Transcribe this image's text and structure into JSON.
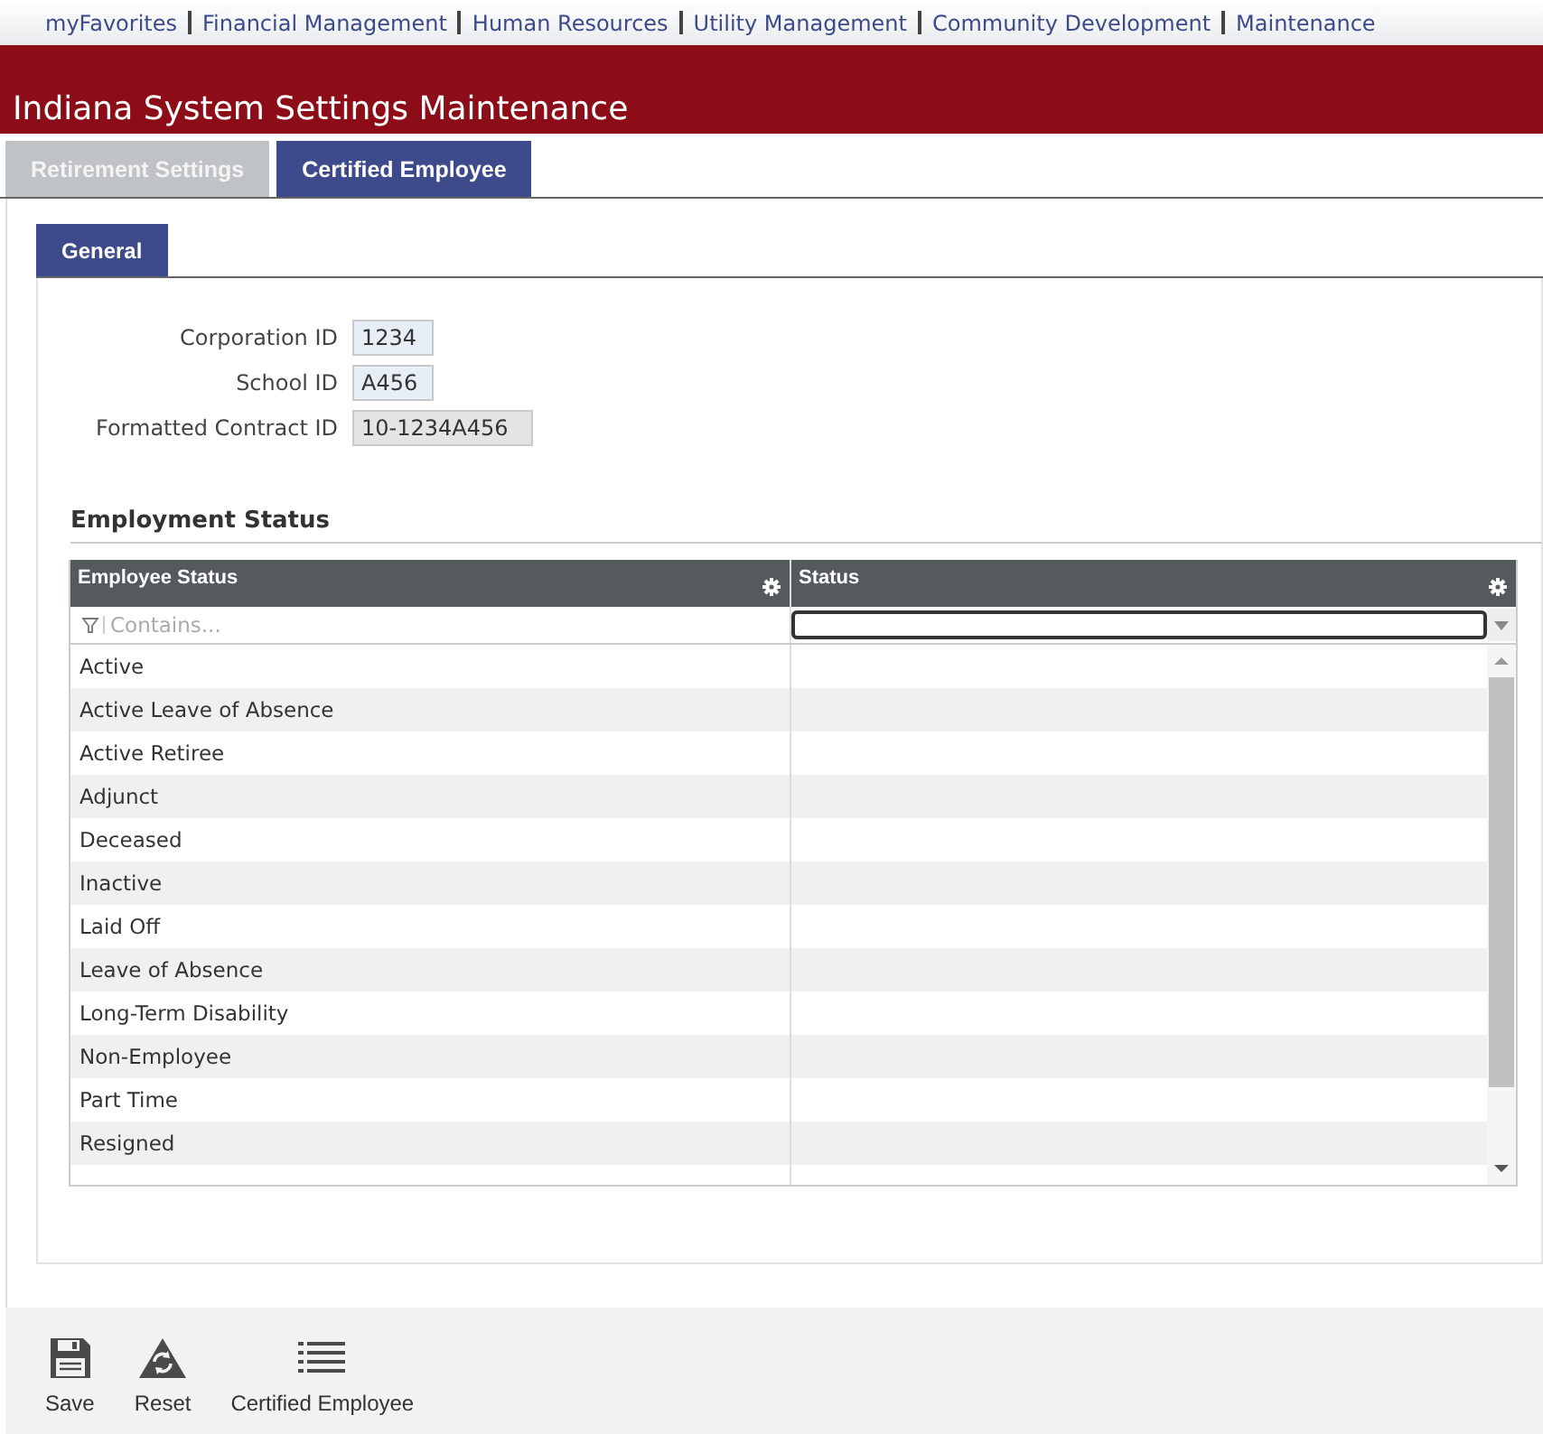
{
  "nav": [
    "myFavorites",
    "Financial Management",
    "Human Resources",
    "Utility Management",
    "Community Development",
    "Maintenance"
  ],
  "title": "Indiana System Settings Maintenance",
  "tabs": [
    {
      "label": "Retirement Settings",
      "selected": false
    },
    {
      "label": "Certified Employee",
      "selected": true
    }
  ],
  "subtabs": [
    {
      "label": "General",
      "selected": true
    }
  ],
  "fields": [
    {
      "label": "Corporation ID",
      "value": "1234",
      "disabled": false
    },
    {
      "label": "School ID",
      "value": "A456",
      "disabled": false
    },
    {
      "label": "Formatted Contract ID",
      "value": "10-1234A456",
      "disabled": true
    }
  ],
  "section": "Employment Status",
  "table": {
    "columns": [
      "Employee Status",
      "Status"
    ],
    "filter_placeholder": "Contains...",
    "rows": [
      "Active",
      "Active Leave of Absence",
      "Active Retiree",
      "Adjunct",
      "Deceased",
      "Inactive",
      "Laid Off",
      "Leave of Absence",
      "Long-Term Disability",
      "Non-Employee",
      "Part Time",
      "Resigned"
    ]
  },
  "toolbar": [
    {
      "kind": "save",
      "label": "Save"
    },
    {
      "kind": "reset",
      "label": "Reset"
    },
    {
      "kind": "list",
      "label": "Certified Employee"
    }
  ]
}
